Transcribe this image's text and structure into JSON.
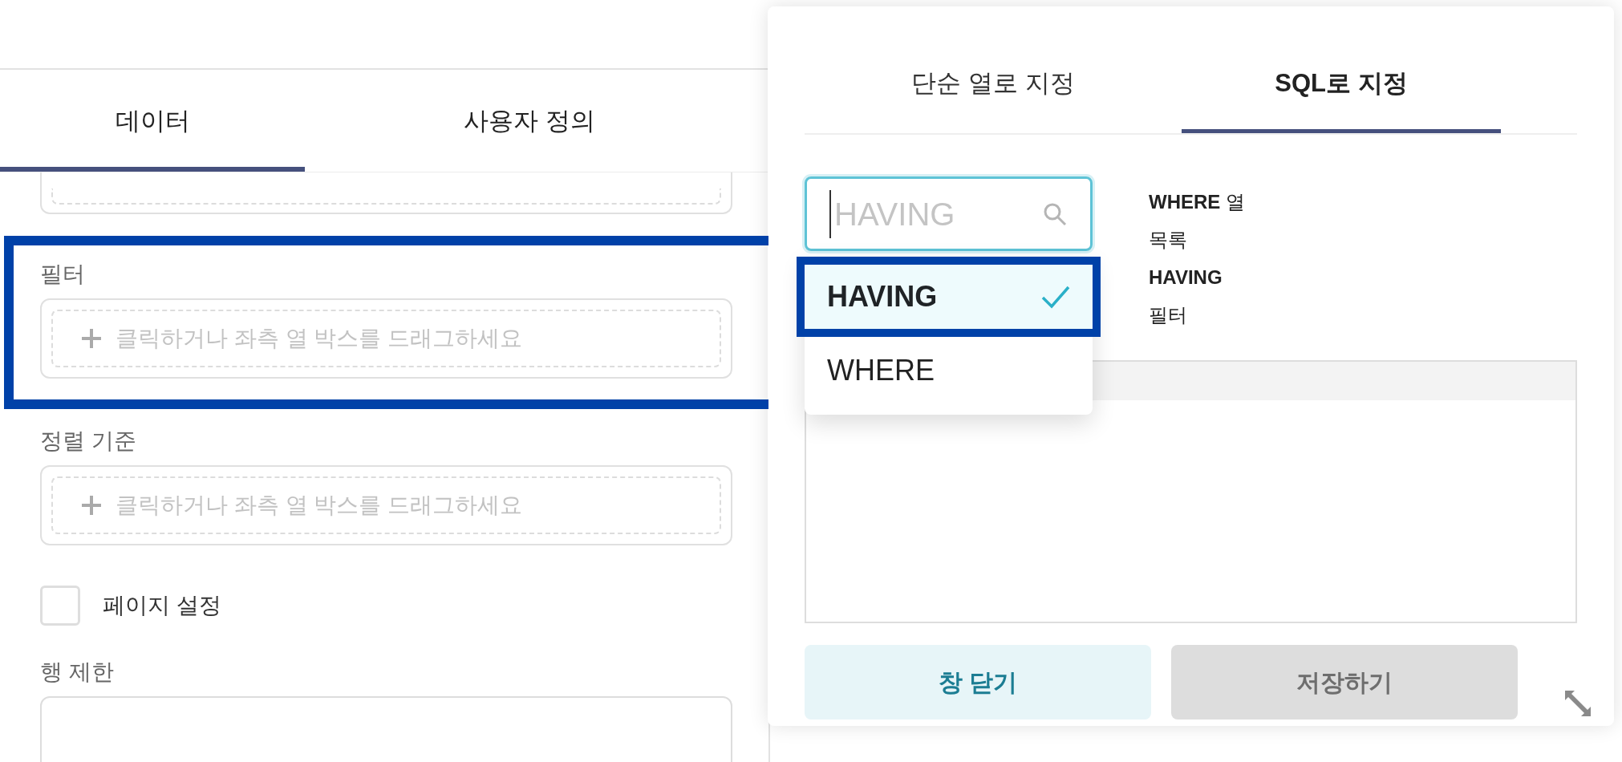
{
  "left_panel": {
    "tabs": [
      {
        "label": "데이터",
        "selected": true
      },
      {
        "label": "사용자 정의",
        "selected": false
      }
    ],
    "fields": [
      {
        "kind": "dropzone",
        "label": "필터",
        "hint": "클릭하거나 좌측 열 박스를 드래그하세요",
        "highlighted": true
      },
      {
        "kind": "dropzone",
        "label": "정렬 기준",
        "hint": "클릭하거나 좌측 열 박스를 드래그하세요",
        "highlighted": false
      },
      {
        "kind": "checkbox",
        "label": "페이지 설정",
        "checked": false
      },
      {
        "kind": "input",
        "label": "행 제한"
      }
    ]
  },
  "popup": {
    "tabs": [
      {
        "label": "단순 열로 지정",
        "selected": false
      },
      {
        "label": "SQL로 지정",
        "selected": true
      }
    ],
    "search": {
      "placeholder": "HAVING"
    },
    "options": [
      {
        "label": "HAVING",
        "selected": true,
        "highlighted": true
      },
      {
        "label": "WHERE",
        "selected": false,
        "highlighted": false
      }
    ],
    "help_lines": [
      {
        "text": "**WHERE** 열",
        "bold": false
      },
      {
        "text": "목록",
        "bold": false
      },
      {
        "text": "HAVING",
        "bold": true
      },
      {
        "text": "필터",
        "bold": false
      }
    ],
    "buttons": [
      {
        "label": "창 닫기",
        "disabled": false
      },
      {
        "label": "저장하기",
        "disabled": true
      }
    ]
  }
}
